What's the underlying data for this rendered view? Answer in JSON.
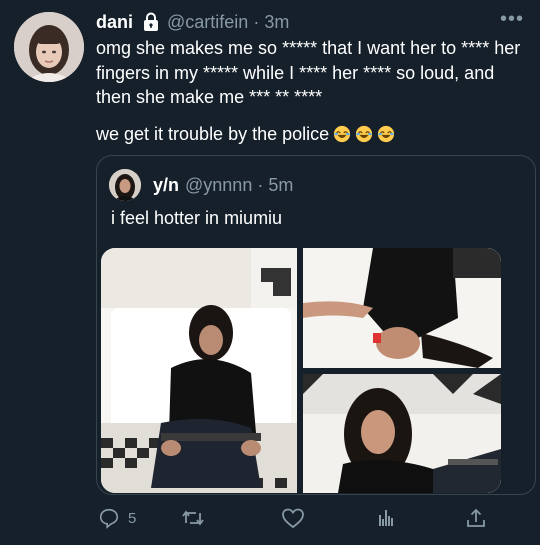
{
  "tweet": {
    "display_name": "dani",
    "handle": "@cartifein",
    "time": "· 3m",
    "text_1": "omg she makes me so ***** that I want her to **** her fingers in my ***** while I **** her **** so loud, and then she make me *** ** ****",
    "text_2": "we get it trouble by the police"
  },
  "quoted": {
    "display_name": "y/n",
    "handle": "@ynnnn",
    "time": "· 5m",
    "text": "i feel hotter in miumiu"
  },
  "actions": {
    "reply_count": "5"
  },
  "colors": {
    "background": "#15202b",
    "border": "#38444d",
    "muted": "#8899a6"
  }
}
